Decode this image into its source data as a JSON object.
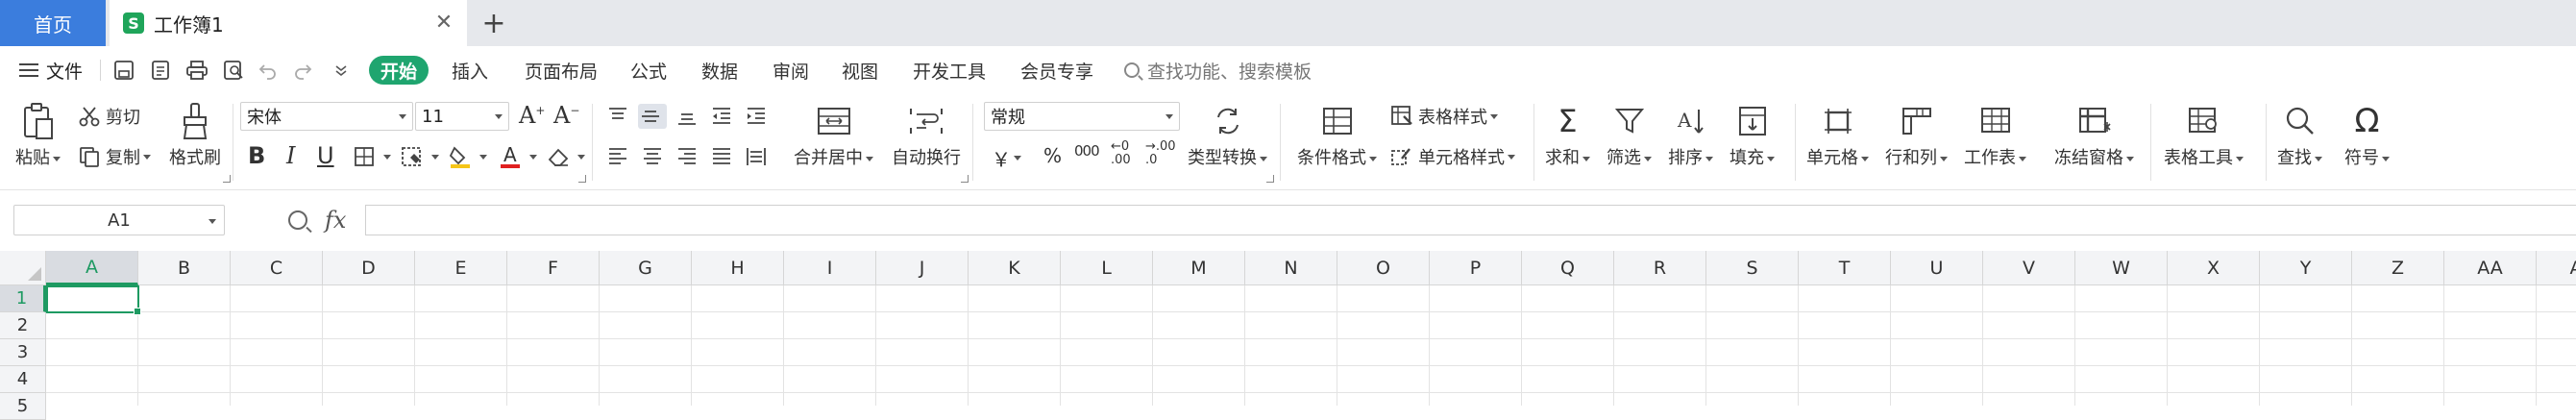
{
  "tabs": {
    "home": "首页",
    "document": "工作簿1",
    "document_icon": "S"
  },
  "menu": {
    "file": "文件",
    "tabs": [
      "开始",
      "插入",
      "页面布局",
      "公式",
      "数据",
      "审阅",
      "视图",
      "开发工具",
      "会员专享"
    ],
    "active_tab": "开始",
    "search_placeholder": "查找功能、搜索模板"
  },
  "ribbon": {
    "clipboard": {
      "paste": "粘贴",
      "cut": "剪切",
      "copy": "复制",
      "format_painter": "格式刷"
    },
    "font": {
      "family": "宋体",
      "size": "11",
      "bold": "B",
      "italic": "I",
      "underline": "U"
    },
    "alignment": {
      "merge_center": "合并居中",
      "wrap_text": "自动换行"
    },
    "number": {
      "format": "常规",
      "currency": "￥",
      "percent": "%",
      "thousands": "000",
      "inc_decimal": "←0 .00",
      "dec_decimal": "→.00 .0",
      "convert": "类型转换"
    },
    "styles": {
      "conditional_format": "条件格式",
      "table_style": "表格样式",
      "cell_style": "单元格样式"
    },
    "editing": {
      "sum": "求和",
      "filter": "筛选",
      "sort": "排序",
      "fill": "填充"
    },
    "cells": {
      "cell": "单元格",
      "row_col": "行和列",
      "worksheet": "工作表",
      "freeze": "冻结窗格"
    },
    "tools": {
      "table_tools": "表格工具",
      "find": "查找",
      "symbol": "符号"
    }
  },
  "formula_bar": {
    "name_box": "A1",
    "fx": "fx",
    "formula": ""
  },
  "grid": {
    "columns": [
      "A",
      "B",
      "C",
      "D",
      "E",
      "F",
      "G",
      "H",
      "I",
      "J",
      "K",
      "L",
      "M",
      "N",
      "O",
      "P",
      "Q",
      "R",
      "S",
      "T",
      "U",
      "V",
      "W",
      "X",
      "Y",
      "Z",
      "AA",
      "AB"
    ],
    "rows": [
      "1",
      "2",
      "3",
      "4",
      "5"
    ],
    "selected_column": "A",
    "selected_row": "1"
  },
  "colors": {
    "accent": "#1fa56f",
    "home_tab": "#3b7ddd",
    "selection": "#1e9a62"
  }
}
